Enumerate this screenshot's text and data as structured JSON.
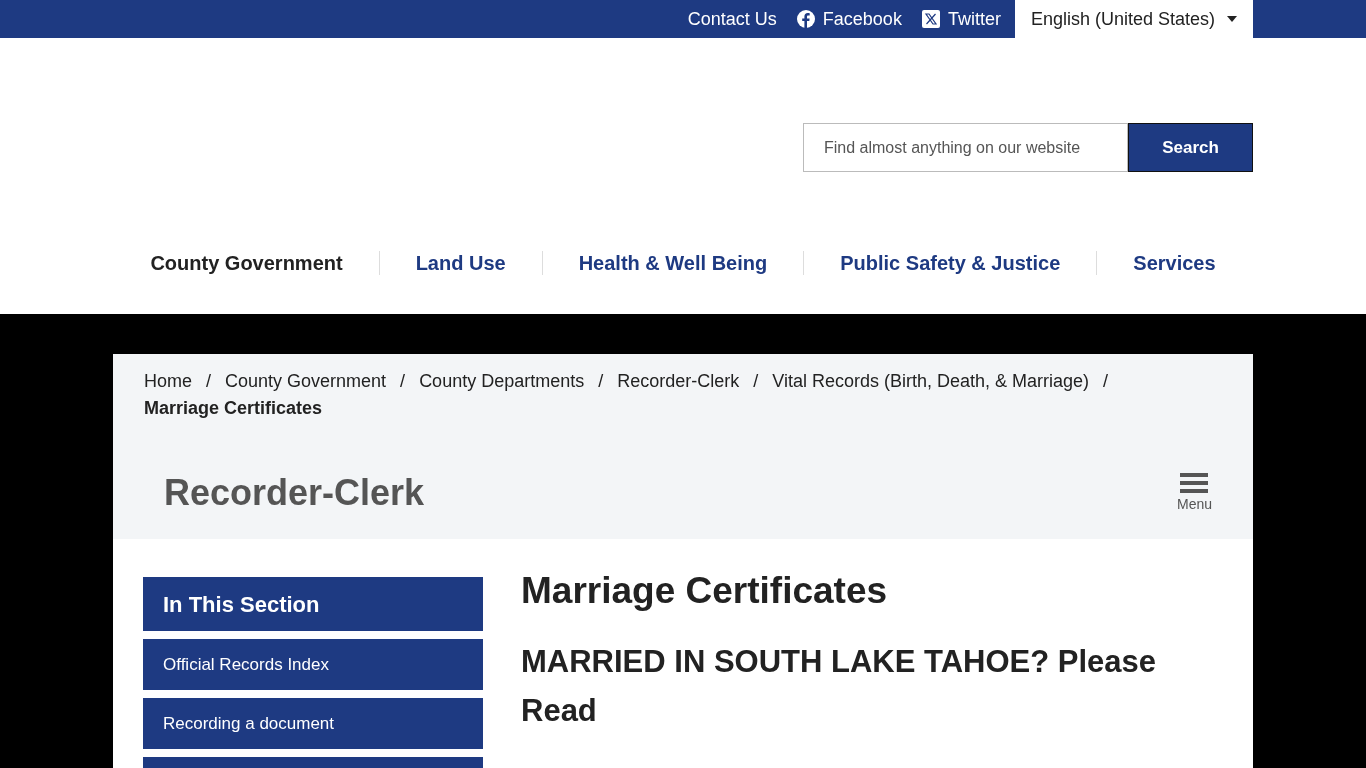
{
  "top_bar": {
    "links": [
      {
        "kind": "text",
        "label": "Contact Us"
      },
      {
        "kind": "facebook",
        "label": "Facebook"
      },
      {
        "kind": "x",
        "label": "Twitter"
      }
    ],
    "language": "English (United States)"
  },
  "search": {
    "placeholder": "Find almost anything on our website",
    "button": "Search"
  },
  "main_nav": [
    {
      "label": "County Government",
      "selected": true
    },
    {
      "label": "Land Use",
      "selected": false
    },
    {
      "label": "Health & Well Being",
      "selected": false
    },
    {
      "label": "Public Safety & Justice",
      "selected": false
    },
    {
      "label": "Services",
      "selected": false
    }
  ],
  "breadcrumb": [
    {
      "label": "Home",
      "current": false,
      "separator": "/"
    },
    {
      "label": "County Government",
      "current": false,
      "separator": "/"
    },
    {
      "label": "County Departments",
      "current": false,
      "separator": "/"
    },
    {
      "label": "Recorder-Clerk",
      "current": false,
      "separator": "/"
    },
    {
      "label": "Vital Records (Birth, Death, & Marriage)",
      "current": false,
      "separator": "/"
    },
    {
      "label": "Marriage Certificates",
      "current": true
    }
  ],
  "department": {
    "title": "Recorder-Clerk",
    "menu_label": "Menu"
  },
  "sidebar": {
    "heading": "In This Section",
    "items": [
      "Official Records Index",
      "Recording a document"
    ]
  },
  "content": {
    "title": "Marriage Certificates",
    "subtitle": "MARRIED IN SOUTH LAKE TAHOE? Please Read"
  }
}
